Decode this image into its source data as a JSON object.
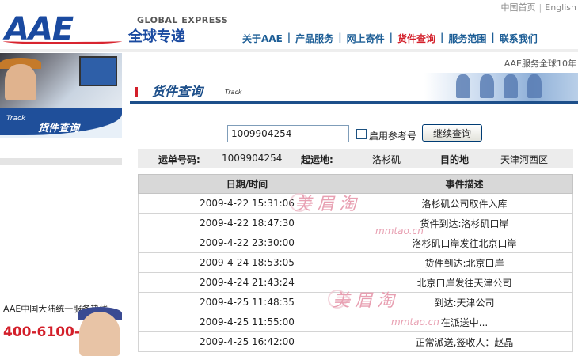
{
  "header": {
    "logo_text": "AAE",
    "brand_en": "GLOBAL EXPRESS",
    "brand_cn": "全球专递",
    "top_links": [
      "中国首页",
      "English"
    ],
    "nav": [
      {
        "label": "关于AAE",
        "active": false
      },
      {
        "label": "产品服务",
        "active": false
      },
      {
        "label": "网上寄件",
        "active": false
      },
      {
        "label": "货件查询",
        "active": true
      },
      {
        "label": "服务范围",
        "active": false
      },
      {
        "label": "联系我们",
        "active": false
      }
    ],
    "slogan": "AAE服务全球10年"
  },
  "left": {
    "banner_track": "Track",
    "banner_title": "货件查询",
    "hotline_label": "AAE中国大陆统一服务热线",
    "hotline_number": "400-6100-400"
  },
  "page": {
    "title": "货件查询",
    "subtitle": "Track"
  },
  "search": {
    "tracking_value": "1009904254",
    "reference_label": "启用参考号",
    "continue_label": "继续查询"
  },
  "summary": {
    "waybill_label": "运单号码:",
    "waybill_value": "1009904254",
    "origin_label": "起运地:",
    "origin_value": "洛杉矶",
    "destination_label": "目的地",
    "destination_value": "天津河西区"
  },
  "events": {
    "headers": [
      "日期/时间",
      "事件描述"
    ],
    "rows": [
      {
        "datetime": "2009-4-22 15:31:06",
        "description": "洛杉矶公司取件入库"
      },
      {
        "datetime": "2009-4-22 18:47:30",
        "description": "货件到达:洛杉矶口岸"
      },
      {
        "datetime": "2009-4-22 23:30:00",
        "description": "洛杉矶口岸发往北京口岸"
      },
      {
        "datetime": "2009-4-24 18:53:05",
        "description": "货件到达:北京口岸"
      },
      {
        "datetime": "2009-4-24 21:43:24",
        "description": "北京口岸发往天津公司"
      },
      {
        "datetime": "2009-4-25 11:48:35",
        "description": "到达:天津公司"
      },
      {
        "datetime": "2009-4-25 11:55:00",
        "description": "在派送中..."
      },
      {
        "datetime": "2009-4-25 16:42:00",
        "description": "正常派送,签收人：赵晶"
      }
    ]
  },
  "watermark": {
    "cn": "美眉淘",
    "url": "mmtao.cn"
  },
  "colors": {
    "brand_blue": "#1a4aa0",
    "nav_blue": "#1d5e96",
    "accent_red": "#d31f2a"
  }
}
